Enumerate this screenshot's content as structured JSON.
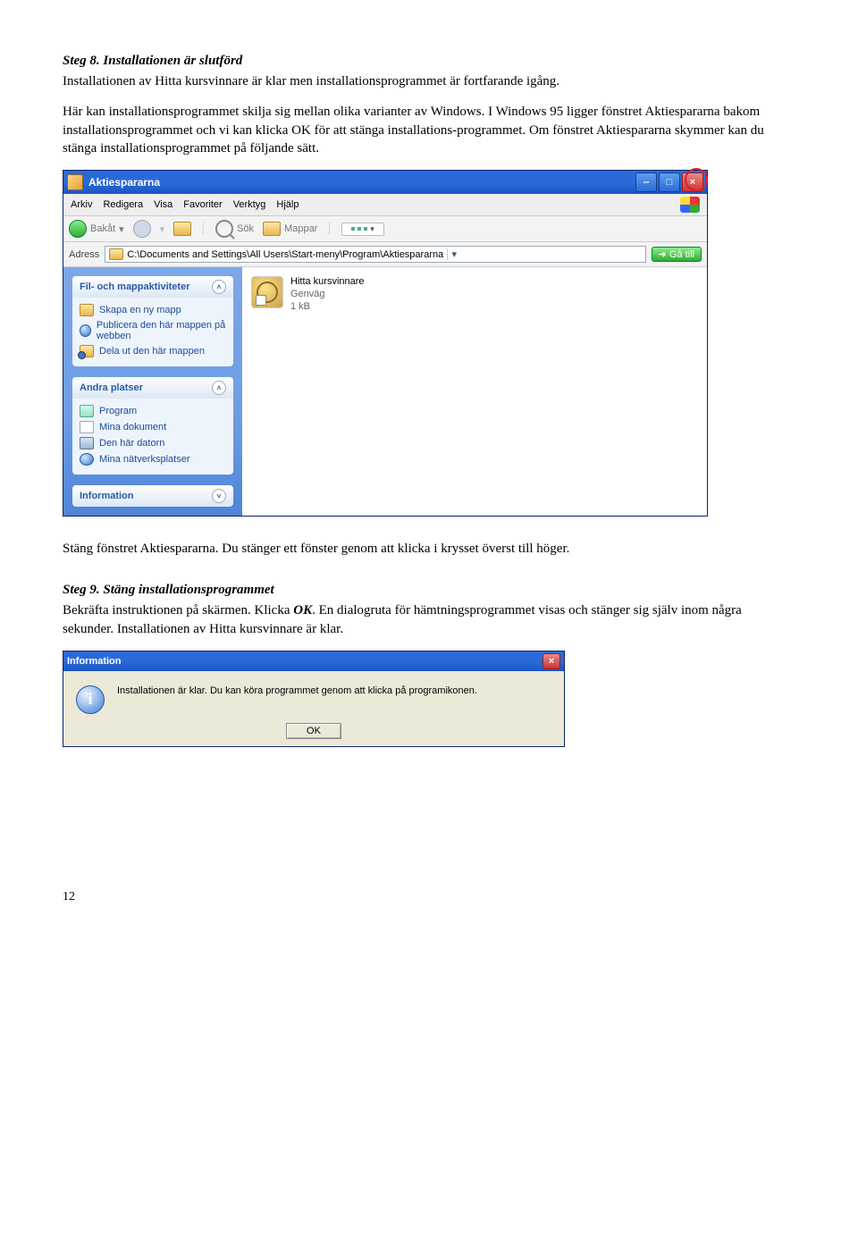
{
  "step8": {
    "heading": "Steg 8. Installationen är slutförd",
    "para1": "Installationen av Hitta kursvinnare är klar men installationsprogrammet är fortfarande igång.",
    "para2": "Här kan installationsprogrammet skilja sig mellan olika varianter av Windows. I Windows 95 ligger fönstret Aktiespararna bakom installationsprogrammet och vi kan klicka OK för att stänga installations-programmet. Om fönstret Aktiespararna skymmer kan du stänga installationsprogrammet på följande sätt."
  },
  "explorer": {
    "title": "Aktiespararna",
    "menu": [
      "Arkiv",
      "Redigera",
      "Visa",
      "Favoriter",
      "Verktyg",
      "Hjälp"
    ],
    "toolbar": {
      "back": "Bakåt",
      "search": "Sök",
      "folders": "Mappar"
    },
    "address": {
      "label": "Adress",
      "path": "C:\\Documents and Settings\\All Users\\Start-meny\\Program\\Aktiespararna",
      "go": "Gå till"
    },
    "sidebar": {
      "panel1": {
        "title": "Fil- och mappaktiviteter",
        "items": [
          "Skapa en ny mapp",
          "Publicera den här mappen på webben",
          "Dela ut den här mappen"
        ]
      },
      "panel2": {
        "title": "Andra platser",
        "items": [
          "Program",
          "Mina dokument",
          "Den här datorn",
          "Mina nätverksplatser"
        ]
      },
      "panel3": {
        "title": "Information"
      }
    },
    "file": {
      "name": "Hitta kursvinnare",
      "type": "Genväg",
      "size": "1 kB"
    }
  },
  "after_explorer": "Stäng fönstret Aktiespararna. Du stänger ett fönster genom att klicka i krysset överst till höger.",
  "step9": {
    "heading": "Steg 9. Stäng installationsprogrammet",
    "para_prefix": "Bekräfta instruktionen på skärmen. Klicka ",
    "ok_word": "OK",
    "para_suffix": ". En dialogruta för hämtningsprogrammet visas och stänger sig själv inom några sekunder. Installationen av Hitta kursvinnare är klar."
  },
  "dialog": {
    "title": "Information",
    "text": "Installationen är klar. Du kan köra programmet genom att klicka på programikonen.",
    "ok": "OK"
  },
  "page_number": "12"
}
